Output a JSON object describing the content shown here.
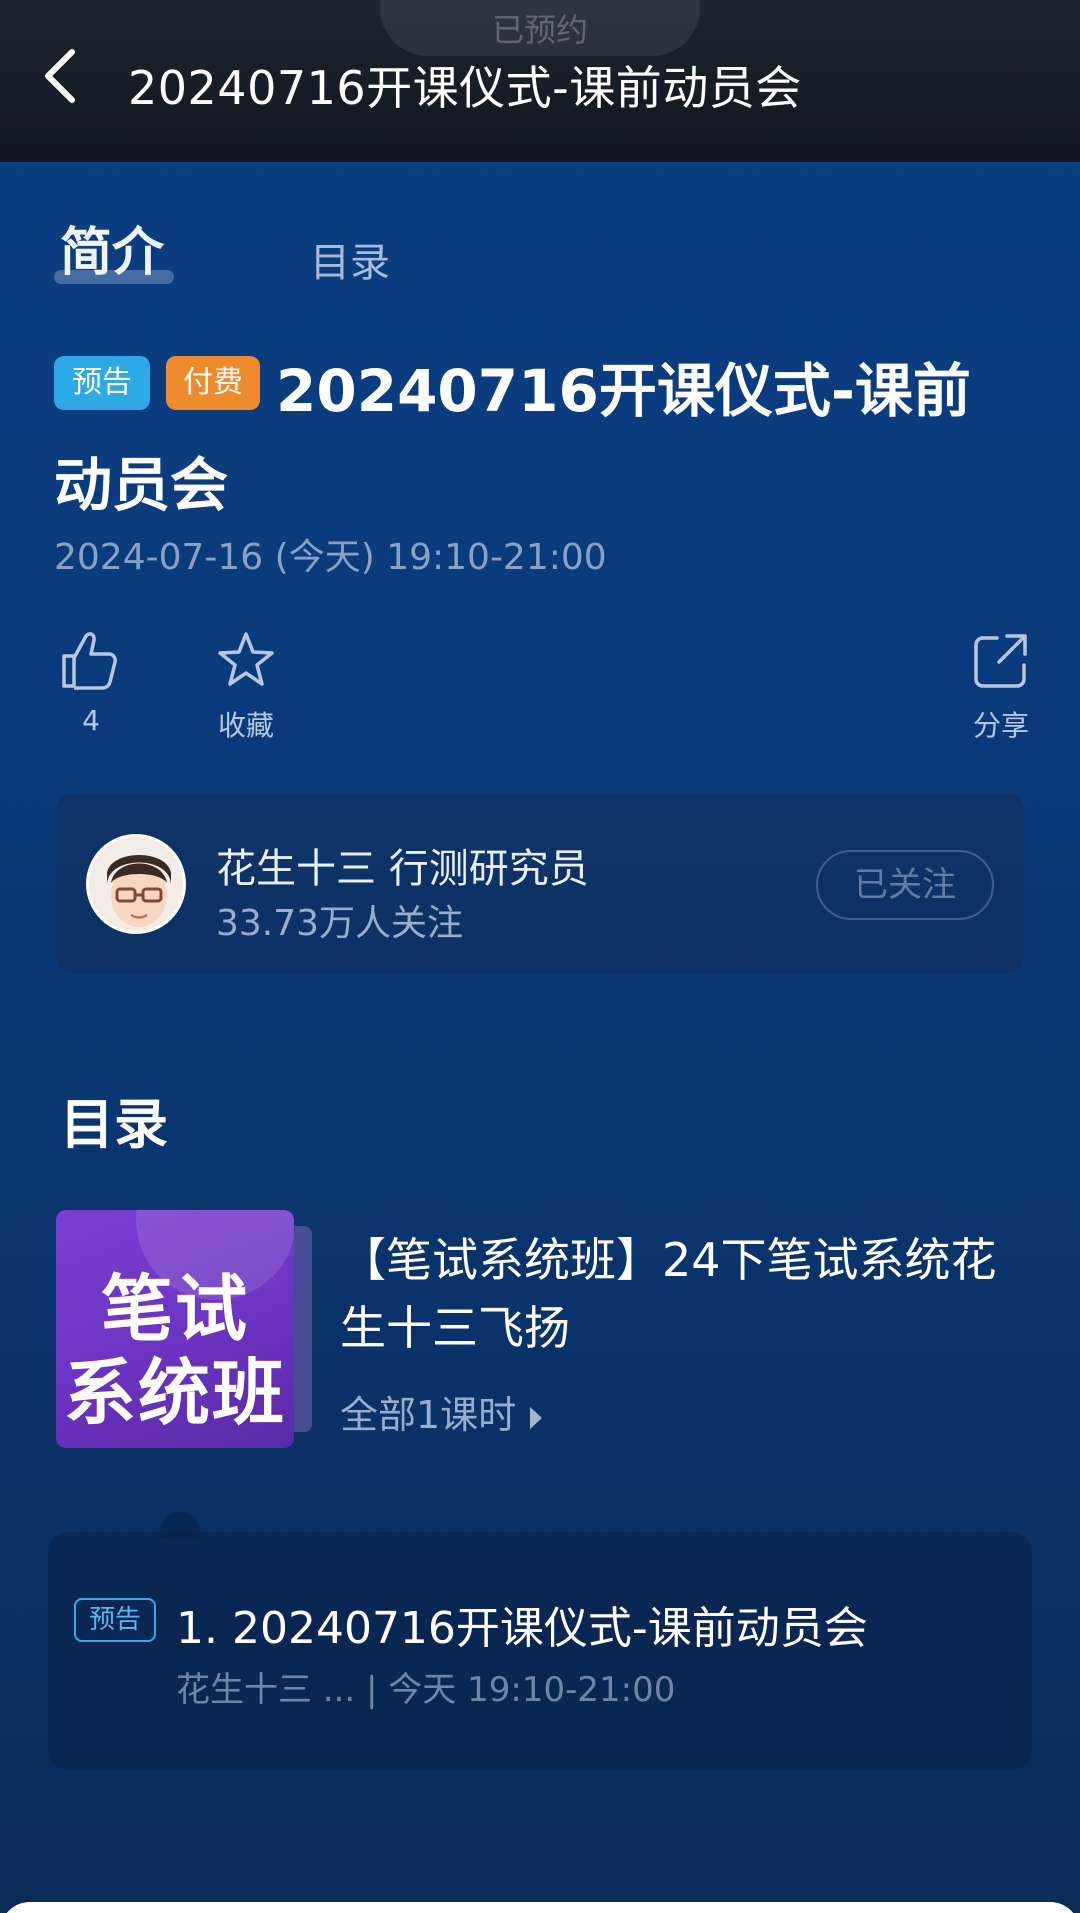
{
  "header": {
    "back_icon": "chevron-left-icon",
    "title": "20240716开课仪式-课前动员会",
    "reservation_pill": "已预约"
  },
  "tabs": [
    {
      "label": "简介",
      "active": true
    },
    {
      "label": "目录",
      "active": false
    }
  ],
  "live": {
    "badge_preview": "预告",
    "badge_paid": "付费",
    "title": "20240716开课仪式-课前动员会",
    "datetime": "2024-07-16 (今天) 19:10-21:00"
  },
  "actions": {
    "like": {
      "icon": "thumbs-up-icon",
      "label": "4"
    },
    "favorite": {
      "icon": "star-icon",
      "label": "收藏"
    },
    "share": {
      "icon": "share-icon",
      "label": "分享"
    }
  },
  "author": {
    "name": "花生十三 行测研究员",
    "followers": "33.73万人关注",
    "follow_button": "已关注"
  },
  "catalog": {
    "title": "目录",
    "course": {
      "thumb_line1": "笔试",
      "thumb_line2": "系统班",
      "title": "【笔试系统班】24下笔试系统花生十三飞扬",
      "count": "全部1课时"
    },
    "lesson": {
      "badge": "预告",
      "title": "1. 20240716开课仪式-课前动员会",
      "meta": "花生十三 ... | 今天 19:10-21:00"
    }
  },
  "colors": {
    "background": "#0b3f83",
    "badge_preview": "#2fa9e6",
    "badge_paid": "#f08a2e",
    "course_thumb": "#7a3fd1"
  }
}
